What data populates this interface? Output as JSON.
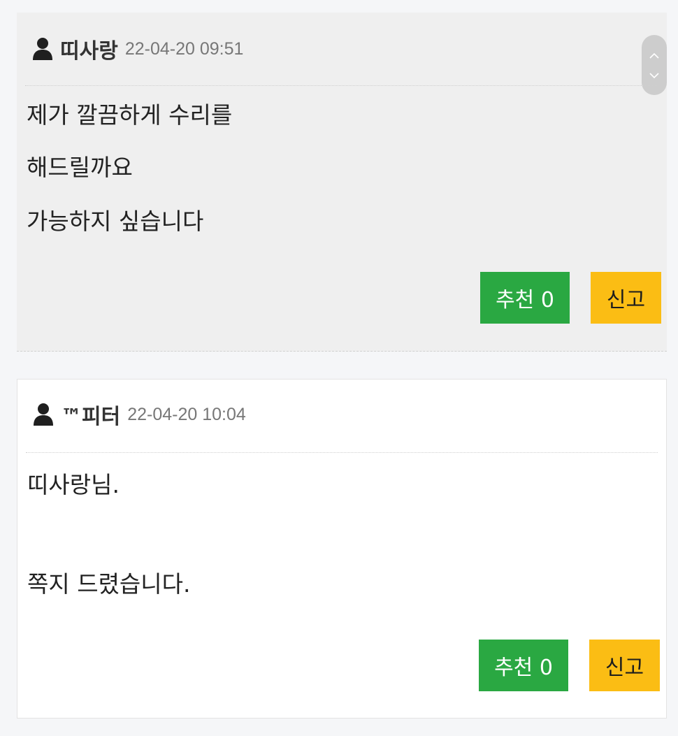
{
  "comments": [
    {
      "author": "띠사랑",
      "date": "22-04-20 09:51",
      "lines": [
        "제가 깔끔하게 수리를",
        "해드릴까요",
        "가능하지 싶습니다"
      ],
      "like_label": "추천 0",
      "report_label": "신고"
    },
    {
      "author": "™피터",
      "date": "22-04-20 10:04",
      "lines": [
        "띠사랑님.",
        "",
        "쪽지 드렸습니다."
      ],
      "like_label": "추천 0",
      "report_label": "신고"
    }
  ],
  "icons": {
    "author_icon": "user-icon",
    "scroll_up": "chevron-up-icon",
    "scroll_down": "chevron-down-icon"
  },
  "colors": {
    "like_button": "#2aa842",
    "report_button": "#fbbd14",
    "highlighted_comment_bg": "#efefef"
  }
}
